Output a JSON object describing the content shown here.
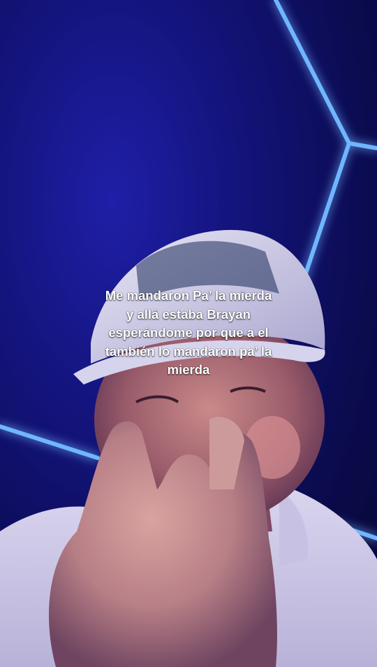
{
  "video": {
    "caption_lines": [
      "Me mandaron Pa’ la mierda",
      "y allá estaba Brayan",
      "esperándome por que a el",
      "también lo mandaron pa’ la",
      "mierda"
    ]
  },
  "colors": {
    "background": "#13137a",
    "neon": "#5aa8ff",
    "caption_text": "#ffffff"
  }
}
